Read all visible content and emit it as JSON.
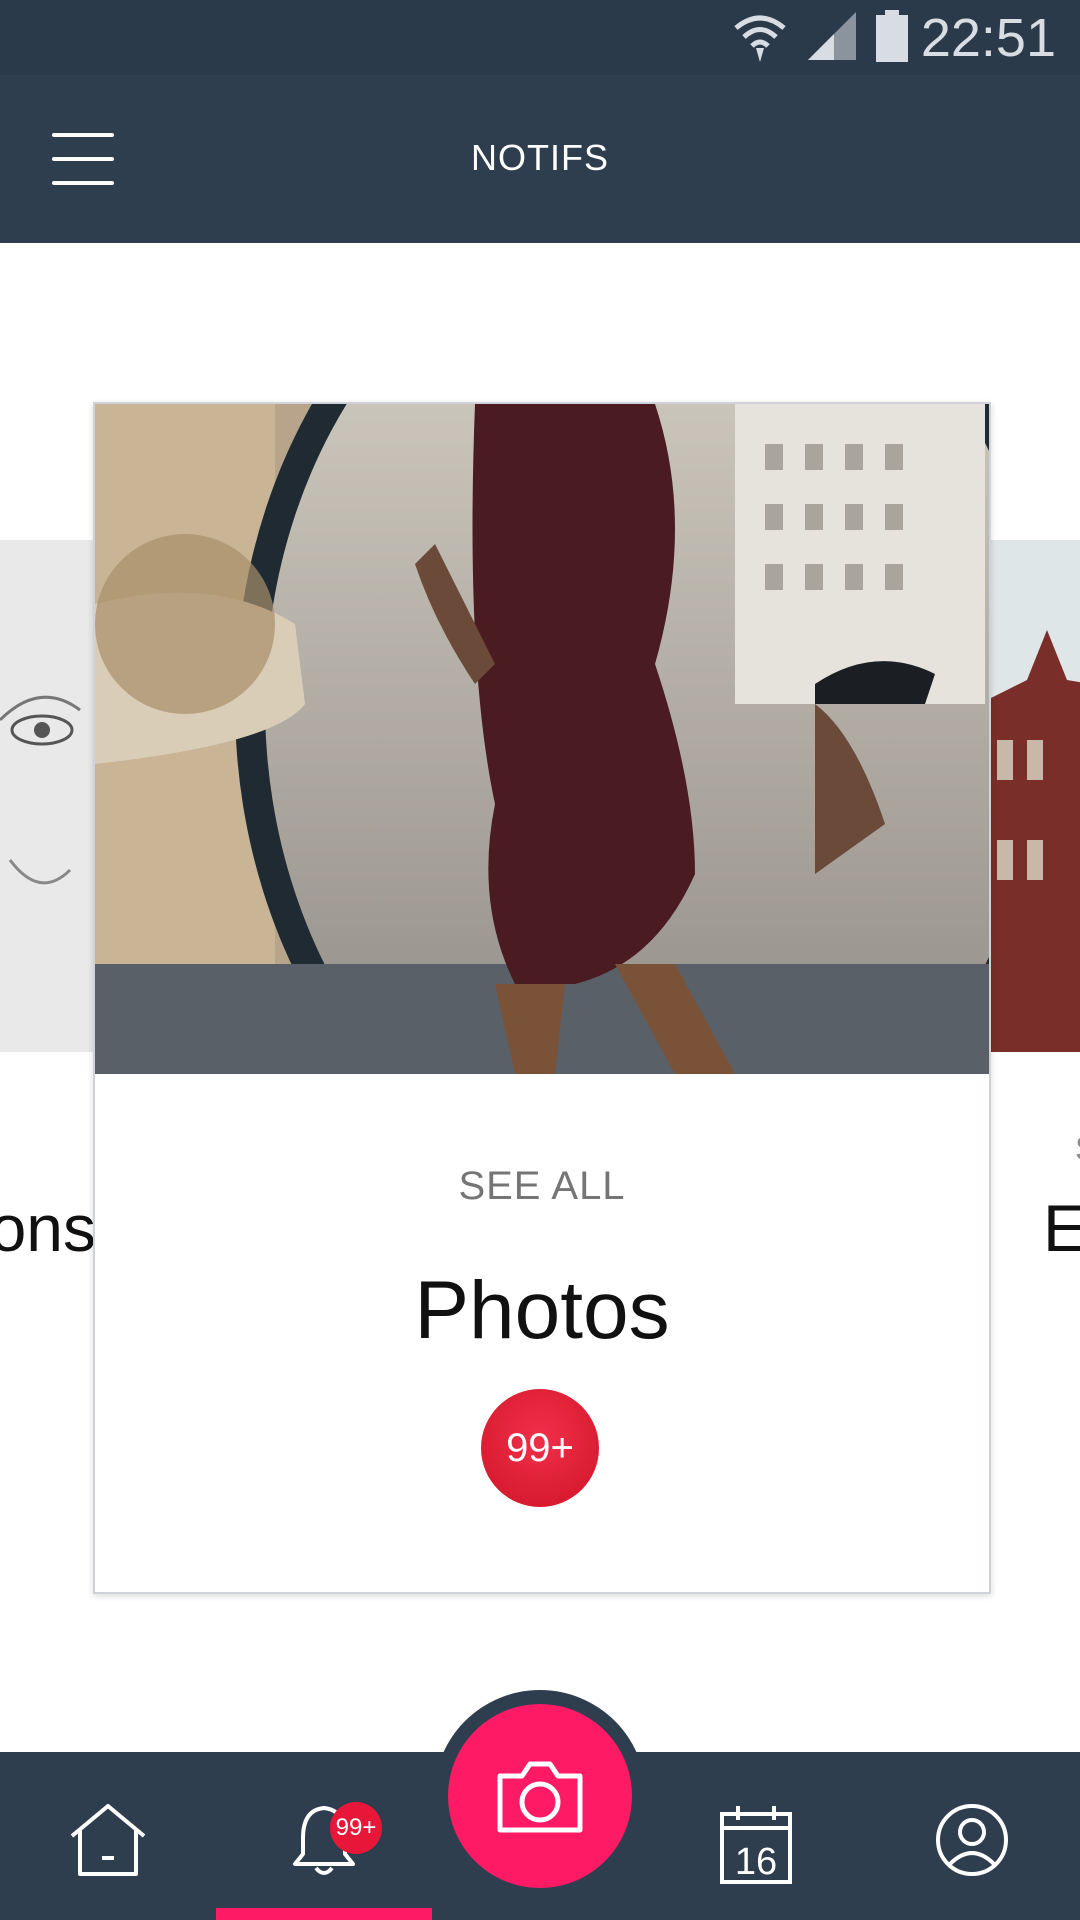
{
  "status_bar": {
    "time": "22:51",
    "icons": [
      "wifi-icon",
      "signal-icon",
      "battery-icon"
    ]
  },
  "app_bar": {
    "title": "NOTIFS",
    "menu_icon": "hamburger-menu-icon"
  },
  "carousel": {
    "left_card": {
      "peek_small": "-",
      "peek_title": "tions"
    },
    "main_card": {
      "link": "SEE ALL",
      "title": "Photos",
      "count": "99+"
    },
    "right_card": {
      "peek_small": "S",
      "peek_title": "Ev"
    }
  },
  "bottom_nav": {
    "items": [
      {
        "name": "home",
        "icon": "home-icon"
      },
      {
        "name": "notifications",
        "icon": "bell-icon",
        "badge": "99+"
      },
      {
        "name": "camera",
        "icon": "camera-icon"
      },
      {
        "name": "calendar",
        "icon": "calendar-icon",
        "day": "16"
      },
      {
        "name": "profile",
        "icon": "user-icon"
      }
    ]
  },
  "colors": {
    "status_bar": "#2b3a4a",
    "app_bar": "#2f3e4f",
    "accent": "#ff1a66",
    "badge": "#e8173a"
  }
}
